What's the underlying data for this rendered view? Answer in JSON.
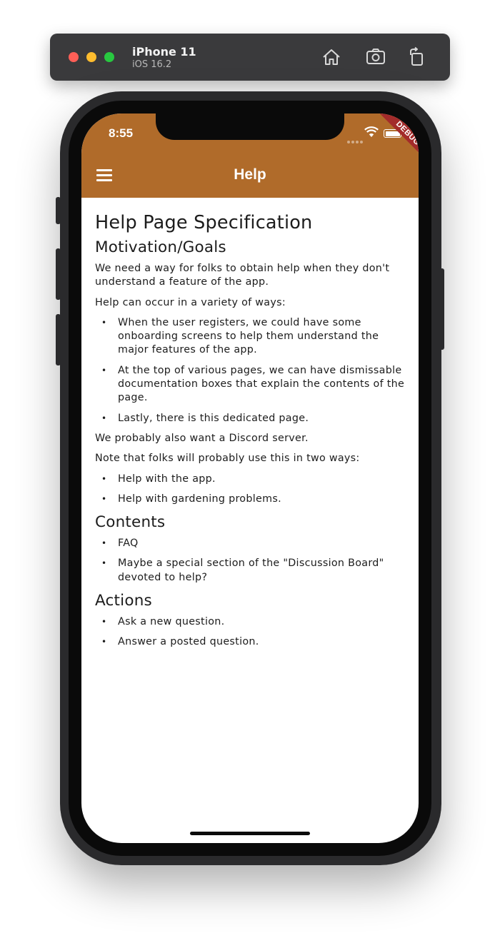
{
  "simulator": {
    "device_name": "iPhone 11",
    "os_version": "iOS 16.2",
    "icons": [
      "home-icon",
      "screenshot-icon",
      "rotate-icon"
    ]
  },
  "status_bar": {
    "time": "8:55",
    "debug_label": "DEBUG"
  },
  "app_bar": {
    "title": "Help",
    "menu_icon": "hamburger-menu-icon",
    "color": "#b06b2a"
  },
  "content": {
    "title": "Help Page Specification",
    "motivation": {
      "heading": "Motivation/Goals",
      "intro": "We need a way for folks to obtain help when they don't understand a feature of the app.",
      "ways_intro": "Help can occur in a variety of ways:",
      "ways": [
        "When the user registers, we could have some onboarding screens to help them understand the major features of the app.",
        "At the top of various pages, we can have dismissable documentation boxes that explain the contents of the page.",
        "Lastly, there is this dedicated page."
      ],
      "discord": "We probably also want a Discord server.",
      "usage_intro": "Note that folks will probably use this in two ways:",
      "usages": [
        "Help with the app.",
        "Help with gardening problems."
      ]
    },
    "contents": {
      "heading": "Contents",
      "items": [
        "FAQ",
        "Maybe a special section of the \"Discussion Board\" devoted to help?"
      ]
    },
    "actions": {
      "heading": "Actions",
      "items": [
        "Ask a new question.",
        "Answer a posted question."
      ]
    }
  }
}
